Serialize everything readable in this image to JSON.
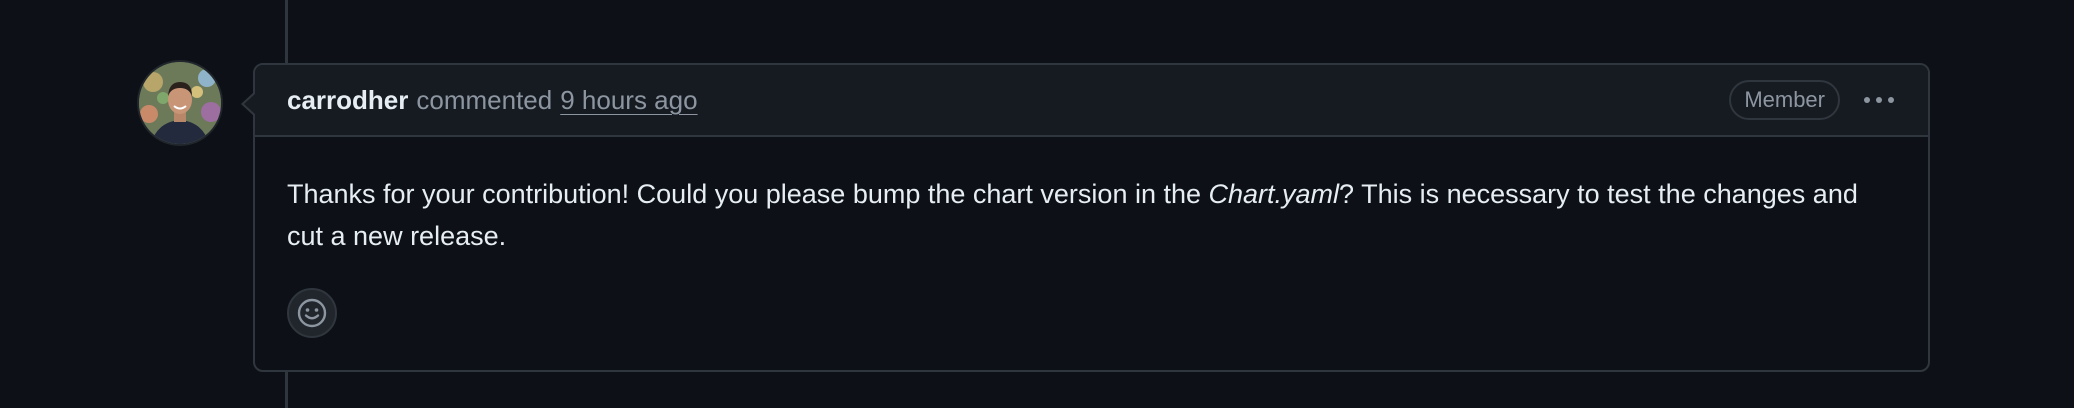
{
  "comment": {
    "author": "carrodher",
    "action": "commented",
    "timestamp": "9 hours ago",
    "role_badge": "Member",
    "body": {
      "before": "Thanks for your contribution! Could you please bump the chart version in the ",
      "emphasis": "Chart.yaml",
      "after": "? This is necessary to test the changes and cut a new release."
    },
    "more_icon": "kebab-horizontal-icon",
    "reaction_icon": "smiley-icon",
    "avatar_icon": "user-avatar"
  },
  "colors": {
    "background": "#0d1117",
    "header_background": "#161b22",
    "border": "#30363d",
    "text_primary": "#e6edf3",
    "text_muted": "#8d96a0"
  }
}
